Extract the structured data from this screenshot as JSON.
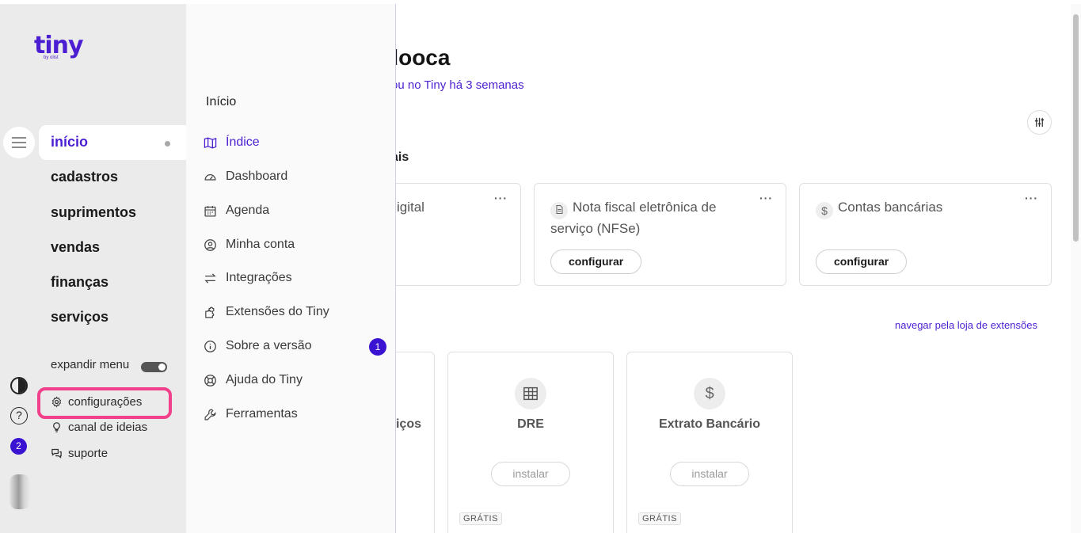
{
  "brand": {
    "wordmark": "tiny",
    "byline": "by olist"
  },
  "nav": {
    "items": [
      {
        "label": "início",
        "active": true
      },
      {
        "label": "cadastros"
      },
      {
        "label": "suprimentos"
      },
      {
        "label": "vendas"
      },
      {
        "label": "finanças"
      },
      {
        "label": "serviços"
      }
    ],
    "expand_label": "expandir menu",
    "settings_label": "configurações",
    "ideas_label": "canal de ideias",
    "support_label": "suporte",
    "notifications_count": "2"
  },
  "flyout": {
    "title": "Início",
    "items": [
      {
        "label": "Índice",
        "icon": "map-icon",
        "active": true
      },
      {
        "label": "Dashboard",
        "icon": "gauge-icon"
      },
      {
        "label": "Agenda",
        "icon": "calendar-icon"
      },
      {
        "label": "Minha conta",
        "icon": "user-circle-icon"
      },
      {
        "label": "Integrações",
        "icon": "arrows-exchange-icon"
      },
      {
        "label": "Extensões do Tiny",
        "icon": "puzzle-icon"
      },
      {
        "label": "Sobre a versão",
        "icon": "info-icon",
        "badge": "1"
      },
      {
        "label": "Ajuda do Tiny",
        "icon": "lifebuoy-icon"
      },
      {
        "label": "Ferramentas",
        "icon": "wrench-icon"
      }
    ]
  },
  "main": {
    "greeting": "dooca",
    "since": "ou no Tiny há 3 semanas",
    "section_setup": "ais",
    "setup_cards": [
      {
        "title": "igital",
        "more": "···"
      },
      {
        "title": "Nota fiscal eletrônica de serviço (NFSe)",
        "icon": "document-icon",
        "button": "configurar",
        "more": "···"
      },
      {
        "title": "Contas bancárias",
        "icon": "dollar-icon",
        "button": "configurar",
        "more": "···"
      }
    ],
    "extensions_link": "navegar pela loja de extensões",
    "extensions": [
      {
        "name": "iços"
      },
      {
        "name": "DRE",
        "icon": "table-icon",
        "button": "instalar",
        "tag": "GRÁTIS"
      },
      {
        "name": "Extrato Bancário",
        "icon": "dollar-icon",
        "button": "instalar",
        "tag": "GRÁTIS"
      }
    ]
  },
  "colors": {
    "accent": "#4b1fd1",
    "highlight": "#f0418a",
    "badge": "#3a12d1"
  }
}
